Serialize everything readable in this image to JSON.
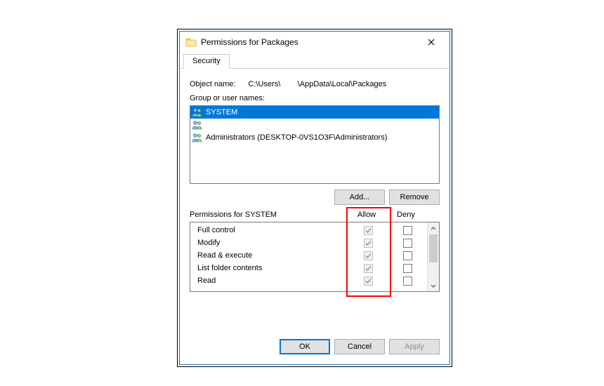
{
  "title": "Permissions for Packages",
  "tabs": [
    "Security"
  ],
  "object_name_label": "Object name:",
  "object_name_value": "C:\\Users\\        \\AppData\\Local\\Packages",
  "group_label": "Group or user names:",
  "principals": [
    {
      "label": "SYSTEM",
      "selected": true
    },
    {
      "label": "",
      "selected": false
    },
    {
      "label": "Administrators (DESKTOP-0VS1O3F\\Administrators)",
      "selected": false
    }
  ],
  "buttons": {
    "add": "Add...",
    "remove": "Remove",
    "ok": "OK",
    "cancel": "Cancel",
    "apply": "Apply"
  },
  "perm_caption": "Permissions for SYSTEM",
  "columns": {
    "allow": "Allow",
    "deny": "Deny"
  },
  "permissions": [
    {
      "name": "Full control",
      "allow": true,
      "allow_readonly": true,
      "deny": false
    },
    {
      "name": "Modify",
      "allow": true,
      "allow_readonly": true,
      "deny": false
    },
    {
      "name": "Read & execute",
      "allow": true,
      "allow_readonly": true,
      "deny": false
    },
    {
      "name": "List folder contents",
      "allow": true,
      "allow_readonly": true,
      "deny": false
    },
    {
      "name": "Read",
      "allow": true,
      "allow_readonly": true,
      "deny": false
    }
  ]
}
